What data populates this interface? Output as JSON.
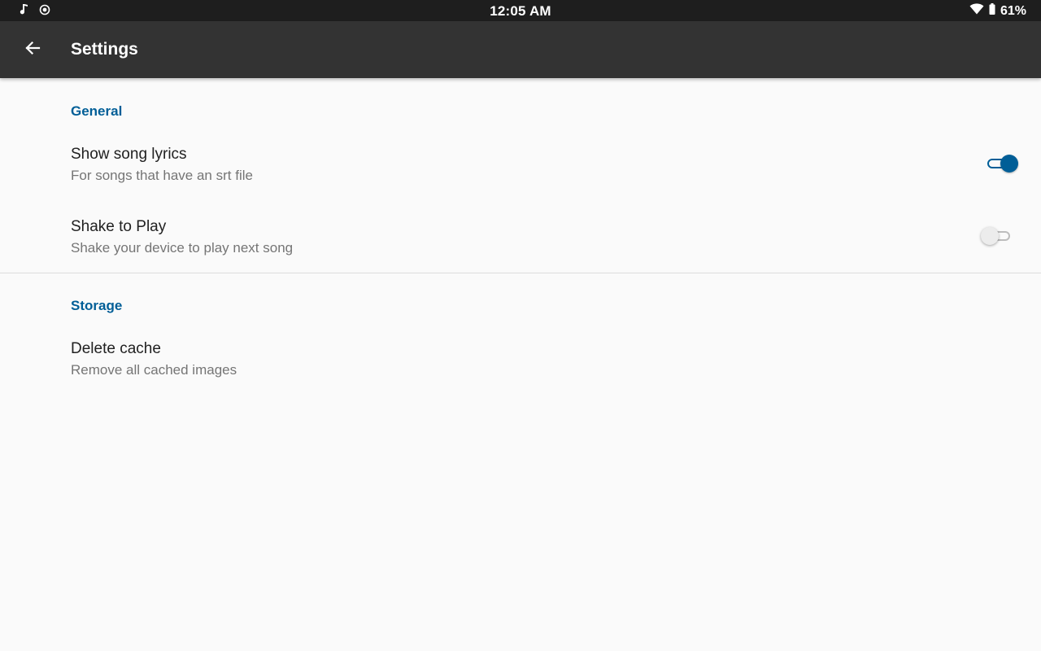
{
  "status_bar": {
    "time": "12:05 AM",
    "battery_percent": "61%",
    "icons": [
      "music-note-icon",
      "sync-circle-icon",
      "wifi-icon",
      "battery-icon"
    ]
  },
  "app_bar": {
    "title": "Settings",
    "back_icon": "arrow-back-icon"
  },
  "colors": {
    "accent": "#005e97",
    "app_bar": "#333333",
    "status_bar": "#1e1e1e",
    "background": "#fafafa"
  },
  "sections": [
    {
      "title": "General",
      "items": [
        {
          "title": "Show song lyrics",
          "summary": "For songs that have an srt file",
          "switch_on": true
        },
        {
          "title": "Shake to Play",
          "summary": "Shake your device to play next song",
          "switch_on": false
        }
      ]
    },
    {
      "title": "Storage",
      "items": [
        {
          "title": "Delete cache",
          "summary": "Remove all cached images"
        }
      ]
    }
  ]
}
